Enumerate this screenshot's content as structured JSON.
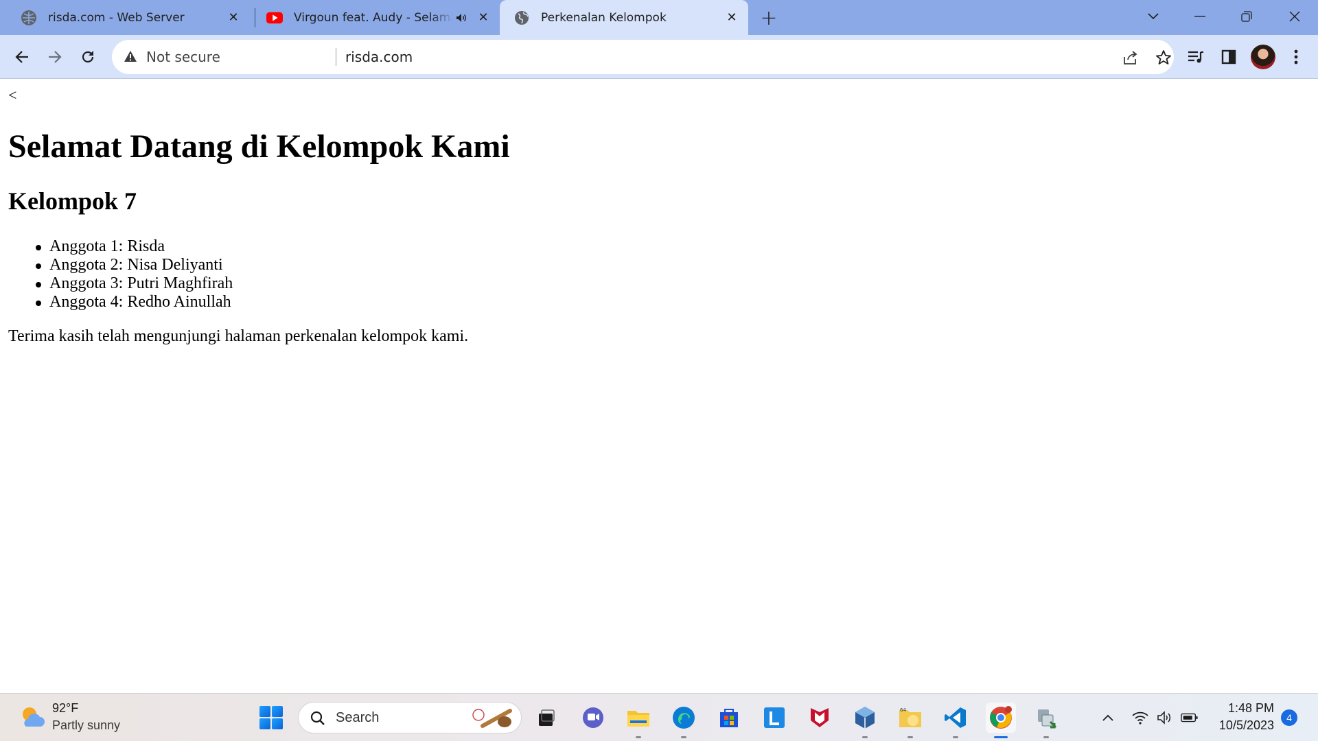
{
  "browser": {
    "tabs": [
      {
        "title": "risda.com - Web Server",
        "favicon": "server-favicon",
        "active": false
      },
      {
        "title": "Virgoun feat. Audy - Selama",
        "favicon": "youtube-favicon",
        "audio": "speaker-icon",
        "active": false
      },
      {
        "title": "Perkenalan Kelompok",
        "favicon": "globe-favicon",
        "active": true
      }
    ],
    "address": {
      "security_label": "Not secure",
      "url": "risda.com"
    },
    "accent": "#8aa9e6",
    "toolbar_bg": "#d6e3fa"
  },
  "page": {
    "back_link": "<",
    "title": "Selamat Datang di Kelompok Kami",
    "group": "Kelompok 7",
    "members": [
      "Anggota 1: Risda",
      "Anggota 2: Nisa Deliyanti",
      "Anggota 3: Putri Maghfirah",
      "Anggota 4: Redho Ainullah"
    ],
    "closing": "Terima kasih telah mengunjungi halaman perkenalan kelompok kami."
  },
  "taskbar": {
    "weather": {
      "temp": "92°F",
      "desc": "Partly sunny",
      "icon": "partly-sunny-icon"
    },
    "search_label": "Search",
    "apps": [
      "task-view",
      "teams-chat",
      "file-explorer",
      "edge",
      "microsoft-store",
      "app-l",
      "mcafee",
      "virtualbox",
      "folder-64",
      "vscode",
      "chrome",
      "network-tool"
    ],
    "clock": {
      "time": "1:48 PM",
      "date": "10/5/2023"
    },
    "notifications": "4"
  }
}
